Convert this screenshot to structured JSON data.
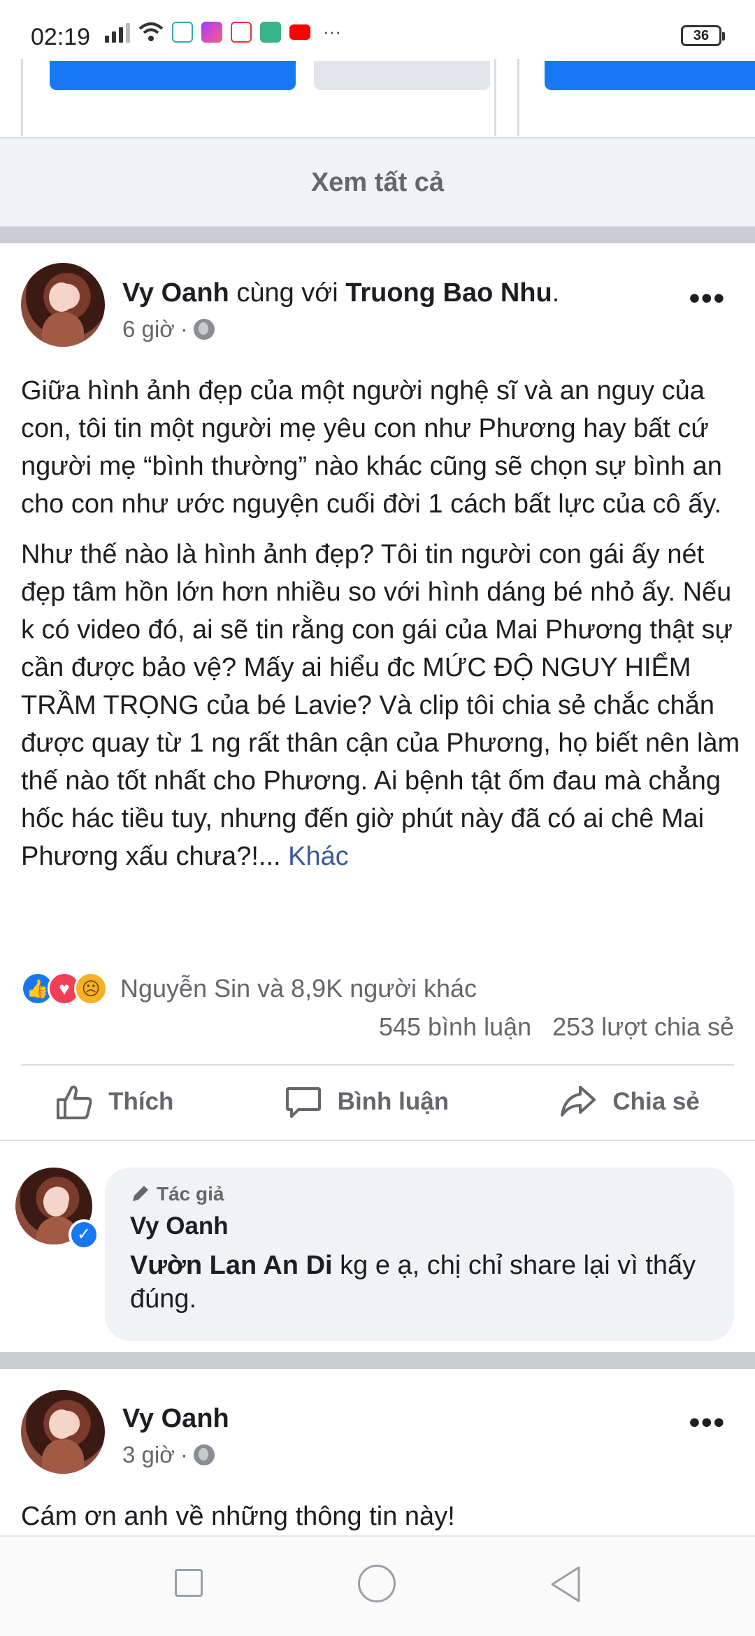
{
  "status_bar": {
    "time": "02:19",
    "battery": "36",
    "app_icons": [
      "signal-icon",
      "wifi-icon",
      "app-icon",
      "messenger-icon",
      "baomoi-icon",
      "app-icon",
      "youtube-icon"
    ],
    "overflow": "···"
  },
  "feed": {
    "see_all": "Xem tất cả"
  },
  "post1": {
    "author": "Vy Oanh",
    "with_text": "cùng với",
    "tagged": "Truong Bao Nhu",
    "tagged_suffix": ".",
    "time": "6 giờ",
    "dot": "·",
    "paragraph1": "Giữa hình ảnh đẹp của một người nghệ sĩ và an nguy của con, tôi tin một người mẹ yêu con như Phương hay bất cứ người mẹ “bình thường” nào khác cũng sẽ chọn sự bình an cho con như ước nguyện cuối đời 1 cách bất lực của cô ấy.",
    "paragraph2": "Như thế nào là hình ảnh đẹp? Tôi tin người con gái ấy nét đẹp tâm hồn lớn hơn nhiều so với hình dáng bé nhỏ ấy. Nếu k có video đó, ai sẽ tin rằng con gái của Mai Phương thật sự cần được bảo vệ? Mấy ai hiểu đc MỨC ĐỘ NGUY HIỂM TRẦM TRỌNG của bé Lavie? Và clip tôi chia sẻ chắc chắn được quay từ 1 ng rất thân cận của Phương, họ biết nên làm thế nào tốt nhất cho Phương. Ai bệnh tật ốm đau mà chẳng hốc hác tiều tuy, nhưng đến giờ phút này đã có ai chê Mai Phương xấu chưa?!...",
    "see_more": "Khác",
    "reactions_text": "Nguyễn Sin và 8,9K người khác",
    "comments_count": "545 bình luận",
    "shares_count": "253 lượt chia sẻ",
    "reaction_icons": [
      "like-icon",
      "love-icon",
      "sad-icon"
    ]
  },
  "actions": {
    "like": "Thích",
    "comment": "Bình luận",
    "share": "Chia sẻ"
  },
  "comment": {
    "author_badge": "Tác giả",
    "author": "Vy Oanh",
    "reply_to": "Vườn Lan An Di",
    "text": "kg e ạ, chị chỉ share lại vì thấy đúng."
  },
  "post2": {
    "author": "Vy Oanh",
    "time": "3 giờ",
    "dot": "·",
    "text": "Cám ơn anh về những thông tin này!"
  },
  "colors": {
    "facebook_blue": "#1877f2",
    "link": "#385898",
    "secondary_text": "#65676b",
    "bubble_bg": "#f0f2f5"
  }
}
